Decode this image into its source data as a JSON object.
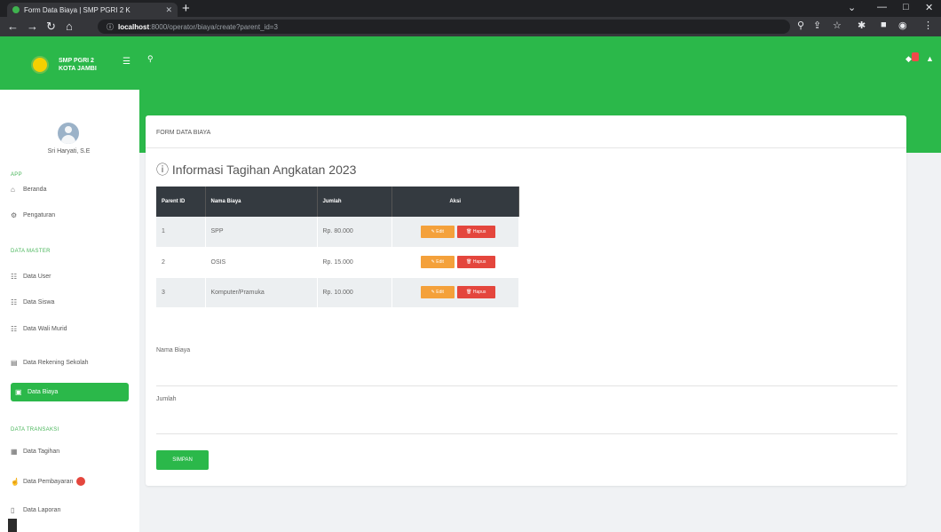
{
  "browser": {
    "tab_title": "Form Data Biaya | SMP PGRI 2 K",
    "url_host": "localhost",
    "url_path": ":8000/operator/biaya/create?parent_id=3",
    "new_tab": "+",
    "tab_close": "✕"
  },
  "app": {
    "brand_line1": "SMP PGRI 2",
    "brand_line2": "KOTA JAMBI"
  },
  "sidebar": {
    "user_name": "Sri Haryati, S.E",
    "section_app": "APP",
    "section_master": "DATA MASTER",
    "section_transaksi": "DATA TRANSAKSI",
    "items_app": [
      {
        "label": "Beranda",
        "icon": "home-icon"
      },
      {
        "label": "Pengaturan",
        "icon": "settings-icon"
      }
    ],
    "items_master": [
      {
        "label": "Data User",
        "icon": "users-icon"
      },
      {
        "label": "Data Siswa",
        "icon": "users-icon"
      },
      {
        "label": "Data Wali Murid",
        "icon": "users-icon"
      },
      {
        "label": "Data Rekening Sekolah",
        "icon": "bank-icon"
      },
      {
        "label": "Data Biaya",
        "icon": "money-icon"
      }
    ],
    "items_transaksi": [
      {
        "label": "Data Tagihan",
        "icon": "calendar-icon"
      },
      {
        "label": "Data Pembayaran",
        "icon": "hand-icon"
      },
      {
        "label": "Data Laporan",
        "icon": "file-icon"
      }
    ]
  },
  "card": {
    "title": "FORM DATA BIAYA",
    "info_title": "Informasi Tagihan Angkatan 2023"
  },
  "table": {
    "headers": [
      "Parent ID",
      "Nama Biaya",
      "Jumlah",
      "Aksi"
    ],
    "rows": [
      {
        "id": "1",
        "nama": "SPP",
        "jumlah": "Rp. 80.000"
      },
      {
        "id": "2",
        "nama": "OSIS",
        "jumlah": "Rp. 15.000"
      },
      {
        "id": "3",
        "nama": "Komputer/Pramuka",
        "jumlah": "Rp. 10.000"
      }
    ],
    "edit_label": "Edit",
    "delete_label": "Hapus"
  },
  "form": {
    "nama_label": "Nama Biaya",
    "jumlah_label": "Jumlah",
    "save_label": "SIMPAN"
  },
  "colors": {
    "brand_green": "#2bb84a",
    "header_dark": "#343a40",
    "edit_orange": "#f4a13b",
    "delete_red": "#e4463d"
  }
}
